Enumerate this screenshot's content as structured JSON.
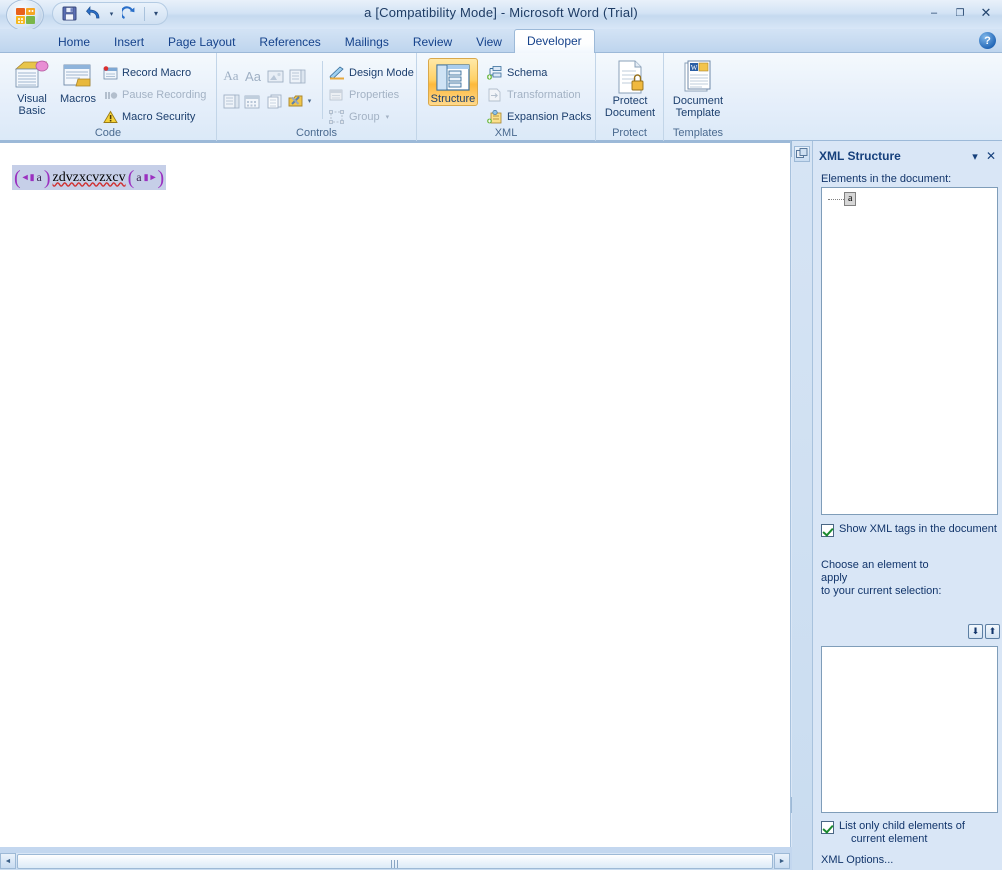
{
  "window": {
    "title": "a [Compatibility Mode] - Microsoft Word (Trial)",
    "minimize_label": "–",
    "maximize_label": "❐",
    "close_label": "✕",
    "help_label": "?",
    "office_button": "office-button",
    "quick_access": [
      {
        "name": "save-button",
        "label": "save-icon"
      },
      {
        "name": "undo-button",
        "label": "undo-icon"
      },
      {
        "name": "undo-dropdown",
        "label": "▾"
      },
      {
        "name": "redo-button",
        "label": "redo-icon"
      },
      {
        "name": "customize-qat-button",
        "label": "▾"
      }
    ]
  },
  "tabs": [
    {
      "label": "Home",
      "active": false
    },
    {
      "label": "Insert",
      "active": false
    },
    {
      "label": "Page Layout",
      "active": false
    },
    {
      "label": "References",
      "active": false
    },
    {
      "label": "Mailings",
      "active": false
    },
    {
      "label": "Review",
      "active": false
    },
    {
      "label": "View",
      "active": false
    },
    {
      "label": "Developer",
      "active": true
    }
  ],
  "ribbon": {
    "groups": [
      {
        "name": "code",
        "label": "Code",
        "big_buttons": [
          {
            "name": "visual-basic-button",
            "line1": "Visual",
            "line2": "Basic"
          },
          {
            "name": "macros-button",
            "line1": "Macros",
            "line2": ""
          }
        ],
        "small_items": [
          {
            "name": "record-macro-button",
            "label": "Record Macro",
            "disabled": false
          },
          {
            "name": "pause-recording-button",
            "label": "Pause Recording",
            "disabled": true
          },
          {
            "name": "macro-security-button",
            "label": "Macro Security",
            "disabled": false
          }
        ]
      },
      {
        "name": "controls",
        "label": "Controls",
        "small_items": [
          {
            "name": "design-mode-button",
            "label": "Design Mode",
            "disabled": false
          },
          {
            "name": "properties-button",
            "label": "Properties",
            "disabled": true
          },
          {
            "name": "group-button",
            "label": "Group",
            "disabled": true,
            "dropdown": "▾"
          }
        ],
        "gallery_row1": [
          {
            "name": "rich-text-control-button",
            "label": "Aa"
          },
          {
            "name": "plain-text-control-button",
            "label": "Aa"
          },
          {
            "name": "picture-control-button",
            "label": "picture-icon"
          },
          {
            "name": "combo-box-control-button",
            "label": "combo-box-icon"
          }
        ],
        "gallery_row2": [
          {
            "name": "drop-down-list-control-button",
            "label": "dropdown-list-icon"
          },
          {
            "name": "date-picker-control-button",
            "label": "calendar-icon"
          },
          {
            "name": "building-block-gallery-button",
            "label": "building-block-icon"
          },
          {
            "name": "legacy-tools-button",
            "label": "legacy-tools-icon",
            "dropdown": "▾"
          }
        ]
      },
      {
        "name": "xml",
        "label": "XML",
        "big_buttons": [
          {
            "name": "structure-button",
            "line1": "Structure",
            "line2": "",
            "selected": true
          }
        ],
        "small_items": [
          {
            "name": "schema-button",
            "label": "Schema",
            "disabled": false
          },
          {
            "name": "transformation-button",
            "label": "Transformation",
            "disabled": true
          },
          {
            "name": "expansion-packs-button",
            "label": "Expansion Packs",
            "disabled": false
          }
        ]
      },
      {
        "name": "protect",
        "label": "Protect",
        "big_buttons": [
          {
            "name": "protect-document-button",
            "line1": "Protect",
            "line2": "Document"
          }
        ],
        "small_items": []
      },
      {
        "name": "templates",
        "label": "Templates",
        "big_buttons": [
          {
            "name": "document-template-button",
            "line1": "Document",
            "line2": "Template"
          }
        ],
        "small_items": []
      }
    ]
  },
  "document": {
    "xml_open_tag": "a",
    "xml_close_tag": "a",
    "body_text": "zdvzxcvzxcv"
  },
  "task_pane": {
    "title": "XML Structure",
    "menu_label": "▾",
    "close_label": "✕",
    "elements_label": "Elements in the document:",
    "tree": [
      {
        "name": "xml-element-a",
        "label": "a"
      }
    ],
    "show_tags_checkbox": {
      "label": "Show XML tags in the document",
      "checked": true
    },
    "choose_element_label_line1": "Choose an element to apply",
    "choose_element_label_line2": "to your current selection:",
    "move_down_label": "⬇",
    "move_up_label": "⬆",
    "apply_list_items": [],
    "list_child_checkbox": {
      "label_line1": "List only child elements of",
      "label_line2": "current element",
      "checked": true
    },
    "options_link": "XML Options..."
  },
  "scrollbars": {
    "v_up": "▲",
    "v_down": "▼",
    "h_left": "◄",
    "h_right": "►",
    "prev_page": "prev-page-icon",
    "select_browse_object": "select-browse-object-icon",
    "next_page": "next-page-icon"
  },
  "colors": {
    "accent": "#15428b",
    "xml_tag": "#8d44ad",
    "selection": "#c6cfe8",
    "highlight": "#ffd166"
  }
}
